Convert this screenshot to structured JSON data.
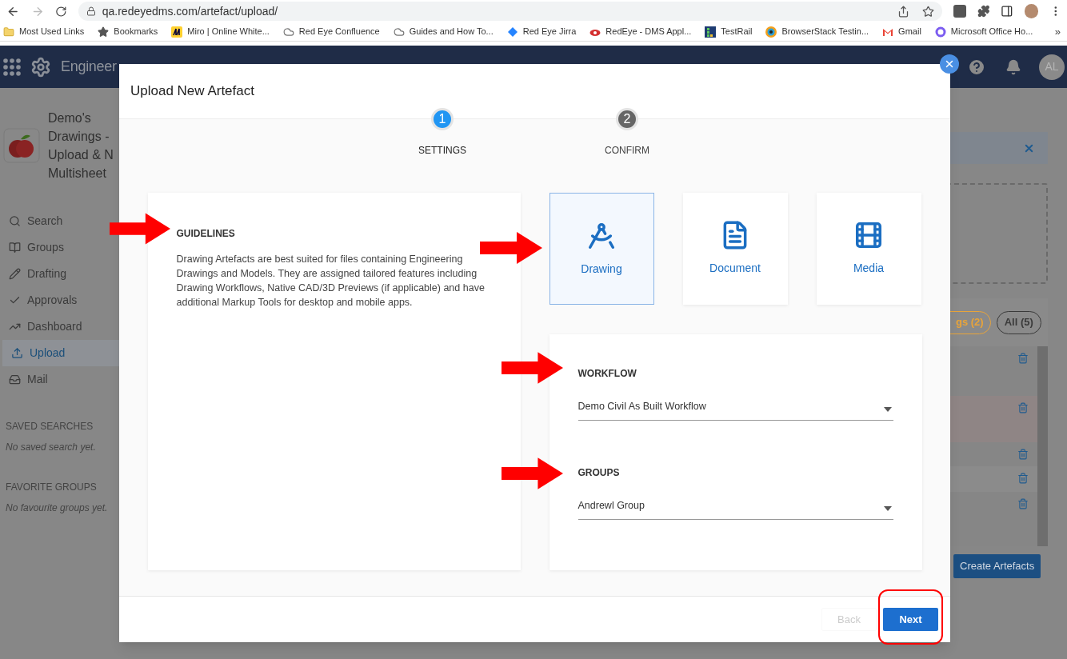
{
  "browser": {
    "url": "qa.redeyedms.com/artefact/upload/",
    "bookmarks": [
      "Most Used Links",
      "Bookmarks",
      "Miro | Online White...",
      "Red Eye Confluence",
      "Guides and How To...",
      "Red Eye Jirra",
      "RedEye - DMS Appl...",
      "TestRail",
      "BrowserStack Testin...",
      "Gmail",
      "Microsoft Office Ho..."
    ],
    "overflow": "»"
  },
  "app": {
    "title": "Engineer",
    "avatar": "AL",
    "project_lines": [
      "Demo's",
      "Drawings -",
      "Upload & N",
      "Multisheet"
    ],
    "nav": [
      {
        "label": "Search",
        "selected": false
      },
      {
        "label": "Groups",
        "selected": false
      },
      {
        "label": "Drafting",
        "selected": false
      },
      {
        "label": "Approvals",
        "selected": false
      },
      {
        "label": "Dashboard",
        "selected": false
      },
      {
        "label": "Upload",
        "selected": true
      },
      {
        "label": "Mail",
        "selected": false
      }
    ],
    "saved_searches": {
      "heading": "SAVED SEARCHES",
      "empty": "No saved search yet."
    },
    "favorite_groups": {
      "heading": "FAVORITE GROUPS",
      "empty": "No favourite groups yet."
    },
    "filter_chips": [
      {
        "label": "gs (2)",
        "color": "#e8a43a"
      },
      {
        "label": "All (5)",
        "color": "#3a3a3a"
      }
    ],
    "create_button": "Create Artefacts"
  },
  "dialog": {
    "title": "Upload New Artefact",
    "steps": [
      {
        "number": "1",
        "label": "SETTINGS",
        "selected": true
      },
      {
        "number": "2",
        "label": "CONFIRM",
        "selected": false
      }
    ],
    "guidelines": {
      "heading": "GUIDELINES",
      "text": "Drawing Artefacts are best suited for files containing Engineering Drawings and Models. They are assigned tailored features including Drawing Workflows, Native CAD/3D Previews (if applicable) and have additional Markup Tools for desktop and mobile apps."
    },
    "types": [
      {
        "kind": "drawing",
        "label": "Drawing",
        "selected": true
      },
      {
        "kind": "document",
        "label": "Document",
        "selected": false
      },
      {
        "kind": "media",
        "label": "Media",
        "selected": false
      }
    ],
    "fields": [
      {
        "label": "WORKFLOW",
        "value": "Demo Civil As Built Workflow"
      },
      {
        "label": "GROUPS",
        "value": "Andrewl Group"
      }
    ],
    "buttons": [
      {
        "label": "Back",
        "kind": "secondary",
        "disabled": true
      },
      {
        "label": "Next",
        "kind": "primary",
        "disabled": false
      }
    ]
  }
}
